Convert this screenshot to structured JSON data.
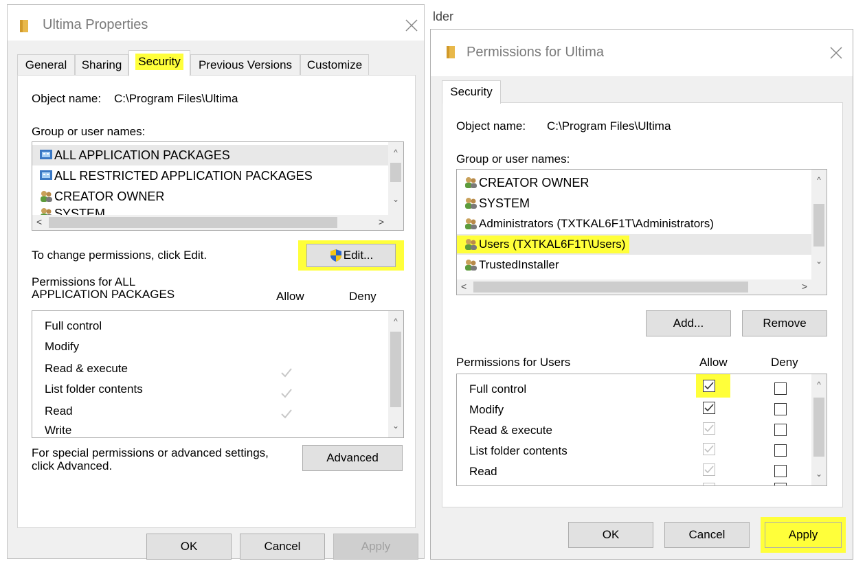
{
  "background_fragment": "lder",
  "left_dialog": {
    "title": "Ultima Properties",
    "tabs": [
      {
        "label": "General"
      },
      {
        "label": "Sharing"
      },
      {
        "label": "Security"
      },
      {
        "label": "Previous Versions"
      },
      {
        "label": "Customize"
      }
    ],
    "object_name_label": "Object name:",
    "object_name_value": "C:\\Program Files\\Ultima",
    "group_label": "Group or user names:",
    "users": [
      {
        "name": "ALL APPLICATION PACKAGES",
        "icon": "app-package-icon"
      },
      {
        "name": "ALL RESTRICTED APPLICATION PACKAGES",
        "icon": "app-package-icon"
      },
      {
        "name": "CREATOR OWNER",
        "icon": "users-icon"
      },
      {
        "name": "SYSTEM",
        "icon": "users-icon"
      }
    ],
    "change_text": "To change permissions, click Edit.",
    "edit_label": "Edit...",
    "perm_header_line1": "Permissions for ALL",
    "perm_header_line2": "APPLICATION PACKAGES",
    "allow_label": "Allow",
    "deny_label": "Deny",
    "permissions": [
      {
        "name": "Full control",
        "allow": false
      },
      {
        "name": "Modify",
        "allow": false
      },
      {
        "name": "Read & execute",
        "allow": true
      },
      {
        "name": "List folder contents",
        "allow": true
      },
      {
        "name": "Read",
        "allow": true
      },
      {
        "name": "Write",
        "allow": false
      }
    ],
    "special_text_1": "For special permissions or advanced settings,",
    "special_text_2": "click Advanced.",
    "advanced_label": "Advanced",
    "ok_label": "OK",
    "cancel_label": "Cancel",
    "apply_label": "Apply"
  },
  "right_dialog": {
    "title": "Permissions for Ultima",
    "tab_label": "Security",
    "object_name_label": "Object name:",
    "object_name_value": "C:\\Program Files\\Ultima",
    "group_label": "Group or user names:",
    "users": [
      {
        "name": "CREATOR OWNER",
        "icon": "users-icon"
      },
      {
        "name": "SYSTEM",
        "icon": "users-icon"
      },
      {
        "name": "Administrators (TXTKAL6F1T\\Administrators)",
        "icon": "users-icon"
      },
      {
        "name": "Users (TXTKAL6F1T\\Users)",
        "icon": "users-icon",
        "selected": true
      },
      {
        "name": "TrustedInstaller",
        "icon": "users-icon"
      }
    ],
    "add_label": "Add...",
    "remove_label": "Remove",
    "perm_header": "Permissions for Users",
    "allow_label": "Allow",
    "deny_label": "Deny",
    "permissions": [
      {
        "name": "Full control",
        "allow": true,
        "allow_inherited": false,
        "deny": false
      },
      {
        "name": "Modify",
        "allow": true,
        "allow_inherited": false,
        "deny": false
      },
      {
        "name": "Read & execute",
        "allow": true,
        "allow_inherited": true,
        "deny": false
      },
      {
        "name": "List folder contents",
        "allow": true,
        "allow_inherited": true,
        "deny": false
      },
      {
        "name": "Read",
        "allow": true,
        "allow_inherited": true,
        "deny": false
      }
    ],
    "ok_label": "OK",
    "cancel_label": "Cancel",
    "apply_label": "Apply"
  },
  "colors": {
    "highlight": "#ffff3a",
    "selected_row": "#ffff3a",
    "dialog_body": "#f0f0f0",
    "button_face": "#e1e1e1"
  }
}
